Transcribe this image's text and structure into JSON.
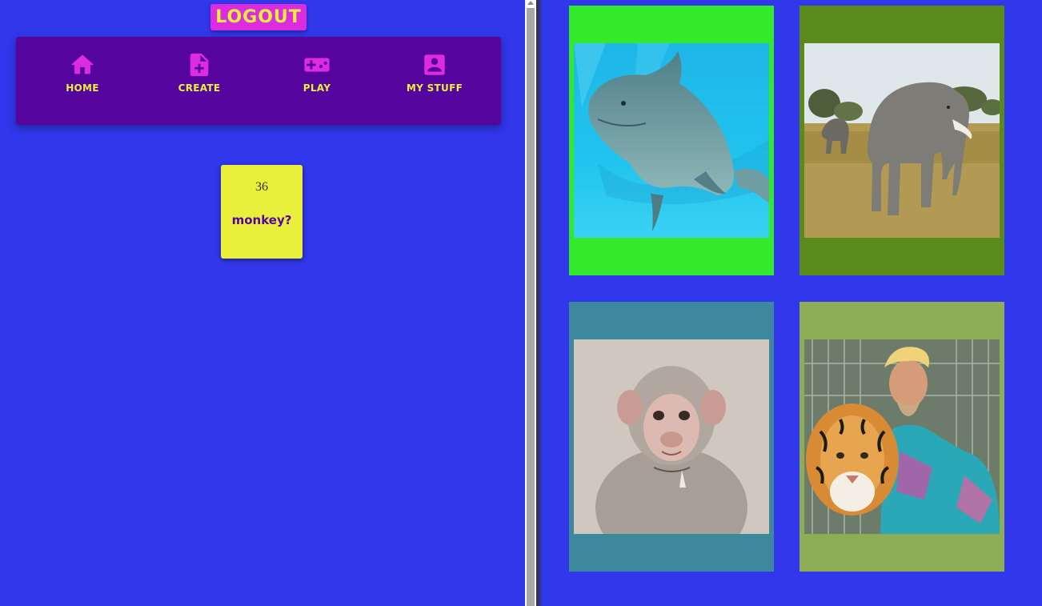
{
  "header": {
    "logout_label": "LOGOUT"
  },
  "nav": {
    "items": [
      {
        "label": "Home",
        "icon": "home-icon"
      },
      {
        "label": "Create",
        "icon": "file-plus-icon"
      },
      {
        "label": "Play",
        "icon": "gamepad-icon"
      },
      {
        "label": "My Stuff",
        "icon": "account-box-icon"
      }
    ]
  },
  "score_card": {
    "number": "36",
    "question": "monkey?"
  },
  "tiles": [
    {
      "picture": "dolphin",
      "bg_color": "#33e92c"
    },
    {
      "picture": "elephant",
      "bg_color": "#5a8a1a"
    },
    {
      "picture": "monkey",
      "bg_color": "#3e889e"
    },
    {
      "picture": "tiger-with-man",
      "bg_color": "#8eae56"
    }
  ],
  "colors": {
    "page_bg": "#3137ea",
    "nav_bg": "#55059d",
    "accent_magenta": "#dc2be0",
    "accent_yellow": "#e8f03b"
  }
}
